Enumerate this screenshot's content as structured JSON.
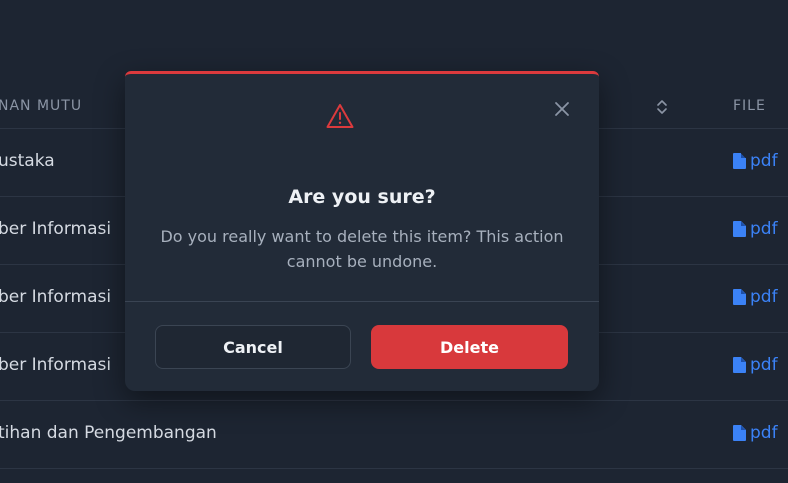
{
  "table": {
    "headers": {
      "mutu": "NAN MUTU",
      "file": "FILE"
    },
    "rows": [
      {
        "text": "ustaka",
        "file": "pdf"
      },
      {
        "text": "ber Informasi",
        "file": "pdf"
      },
      {
        "text": "ber Informasi",
        "file": "pdf"
      },
      {
        "text": "ber Informasi",
        "file": "pdf"
      },
      {
        "text": "tihan dan Pengembangan",
        "file": "pdf"
      }
    ]
  },
  "modal": {
    "title": "Are you sure?",
    "message": "Do you really want to delete this item? This action cannot be undone.",
    "cancel_label": "Cancel",
    "delete_label": "Delete",
    "icons": {
      "warning": "warning-triangle-icon",
      "close": "close-icon"
    }
  },
  "colors": {
    "background": "#1d2532",
    "modal_bg": "#222b38",
    "accent_danger": "#dc3a3d",
    "link": "#3b82f6"
  }
}
